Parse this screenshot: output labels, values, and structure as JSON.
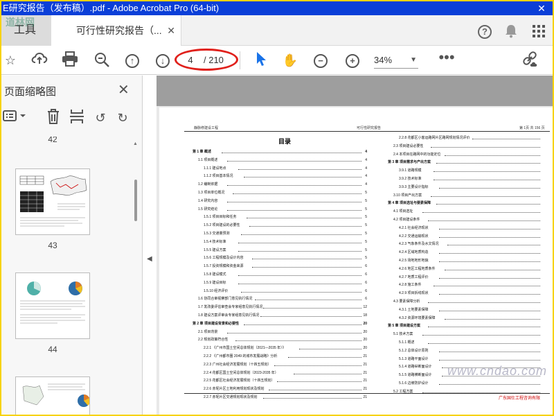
{
  "window": {
    "title": "E研究报告（发布稿）.pdf - Adobe Acrobat Pro (64-bit)",
    "close_glyph": "✕"
  },
  "tabs": {
    "tools_label": "工具",
    "doc_label": "可行性研究报告（...",
    "close_glyph": "✕"
  },
  "header_icons": [
    "help-icon",
    "bell-icon",
    "apps-icon"
  ],
  "toolbar": {
    "icons": [
      "star-icon",
      "upload-cloud-icon",
      "print-icon",
      "zoom-search-icon",
      "page-up-icon",
      "page-down-icon",
      "select-pointer-icon",
      "hand-icon",
      "zoom-out-icon",
      "zoom-in-icon",
      "more-icon",
      "share-link-icon"
    ],
    "current_page": "4",
    "total_pages": "/ 210",
    "zoom": "34%"
  },
  "sidebar": {
    "title": "页面缩略图",
    "close_glyph": "✕",
    "tools": [
      "page-options-icon",
      "delete-icon",
      "insert-page-icon",
      "rotate-left-icon",
      "rotate-right-icon"
    ],
    "partial_label": "42",
    "thumbnails": [
      {
        "label": "43"
      },
      {
        "label": "44"
      }
    ]
  },
  "document": {
    "header_left": "静脉修建设工程",
    "header_center": "可行性研究报告",
    "header_right": "第 1页  共 156 页",
    "toc_title": "目录",
    "toc_left": [
      {
        "t": "第 1 章  概述",
        "p": "4",
        "ch": true
      },
      {
        "t": "1.1  项目概述",
        "p": "4"
      },
      {
        "t": "1.1.1  建设地点",
        "p": "4"
      },
      {
        "t": "1.1.2  项目基本情况",
        "p": "4"
      },
      {
        "t": "1.2  编制依据",
        "p": "4"
      },
      {
        "t": "1.3  项目单位概况",
        "p": "5"
      },
      {
        "t": "1.4  研究内容",
        "p": "5"
      },
      {
        "t": "1.5  研究结论",
        "p": "5"
      },
      {
        "t": "1.5.1  项目目标和任务",
        "p": "5"
      },
      {
        "t": "1.5.2  项目建设的必要性",
        "p": "5"
      },
      {
        "t": "1.5.3  交通量预测",
        "p": "5"
      },
      {
        "t": "1.5.4  技术标准",
        "p": "5"
      },
      {
        "t": "1.5.5  建设方案",
        "p": "5"
      },
      {
        "t": "1.5.6  工程规模及设计内容",
        "p": "5"
      },
      {
        "t": "1.5.7  投资规模和资金来源",
        "p": "6"
      },
      {
        "t": "1.5.8  建设模式",
        "p": "6"
      },
      {
        "t": "1.5.9  建设目标",
        "p": "6"
      },
      {
        "t": "1.5.10  经济评价",
        "p": "6"
      },
      {
        "t": "1.6  协同合审视察部门意见执行情况",
        "p": "6"
      },
      {
        "t": "1.7  发改委评估审查会专家组意见执行情况",
        "p": "12"
      },
      {
        "t": "1.8  建设方案评审会专家组意见执行情况",
        "p": "18"
      },
      {
        "t": "第 2 章  项目建设背景和必要性",
        "p": "20",
        "ch": true
      },
      {
        "t": "2.1  项目背景",
        "p": "20"
      },
      {
        "t": "2.2  规划政策符合性",
        "p": "20"
      },
      {
        "t": "2.2.1  《广州市国土空间总体规划（2021—2035 年）》",
        "p": "20"
      },
      {
        "t": "2.2.2  《广州都市圈 2049 的城市发展战略》分析",
        "p": "21"
      },
      {
        "t": "2.2.3  广州社会经济发展规划（十四五规划）",
        "p": "21"
      },
      {
        "t": "2.2.4  花都区国土空间总体规划（2023-2035 年）",
        "p": "21"
      },
      {
        "t": "2.2.5  花都区社会经济发展规划（十四五规划）",
        "p": "21"
      },
      {
        "t": "2.2.6  赤坭片区土地利用规划现状及规划",
        "p": "21"
      },
      {
        "t": "2.2.7  赤坭片区交通规划现状及规划",
        "p": "21"
      }
    ],
    "toc_right": [
      {
        "t": "2.2.8  花都区小客运路网片区路网规划情况评价",
        "p": ""
      },
      {
        "t": "2.3  项目建设必要性",
        "p": ""
      },
      {
        "t": "2.4  本项目在路网中的功能定位",
        "p": ""
      },
      {
        "t": "第 3 章  项目需求与产出方案",
        "p": "",
        "ch": true
      },
      {
        "t": "3.9.1  道路规模",
        "p": ""
      },
      {
        "t": "3.9.2  技术标准",
        "p": ""
      },
      {
        "t": "3.9.3  主要设计指标",
        "p": ""
      },
      {
        "t": "3.10  项目产出方案",
        "p": ""
      },
      {
        "t": "第 4 章  项目选址与要素保障",
        "p": "",
        "ch": true
      },
      {
        "t": "4.1  项目选址",
        "p": ""
      },
      {
        "t": "4.2  项目建设条件",
        "p": ""
      },
      {
        "t": "4.2.1  社会经济现状",
        "p": ""
      },
      {
        "t": "4.2.2  交通运输现状",
        "p": ""
      },
      {
        "t": "4.2.3  气象条件及水文情况",
        "p": ""
      },
      {
        "t": "4.2.4  区域地质构造",
        "p": ""
      },
      {
        "t": "4.2.5  场地地形地貌",
        "p": ""
      },
      {
        "t": "4.2.6  地区工程地质条件",
        "p": ""
      },
      {
        "t": "4.2.7  地质工程评价",
        "p": ""
      },
      {
        "t": "4.2.8  施工条件",
        "p": ""
      },
      {
        "t": "4.2.9  项目拆线现状",
        "p": ""
      },
      {
        "t": "4.3  要素保障分析",
        "p": ""
      },
      {
        "t": "4.3.1  土地要素保障",
        "p": ""
      },
      {
        "t": "4.3.2  资源环境要素保障",
        "p": ""
      },
      {
        "t": "第 5 章  项目建设方案",
        "p": "",
        "ch": true
      },
      {
        "t": "5.1  技术方案",
        "p": ""
      },
      {
        "t": "5.1.1  概述",
        "p": ""
      },
      {
        "t": "5.1.2  总体设计原则",
        "p": ""
      },
      {
        "t": "5.1.3  道路平面设计",
        "p": ""
      },
      {
        "t": "5.1.4  道路纵断面设计",
        "p": ""
      },
      {
        "t": "5.1.5  道路横断面设计",
        "p": ""
      },
      {
        "t": "5.1.6  边坡防护设计",
        "p": ""
      },
      {
        "t": "5.2  工程方案",
        "p": ""
      }
    ],
    "watermark": "www.cndao.com",
    "stamp": "广东国仕工程咨询有限",
    "logo": "道林网"
  }
}
